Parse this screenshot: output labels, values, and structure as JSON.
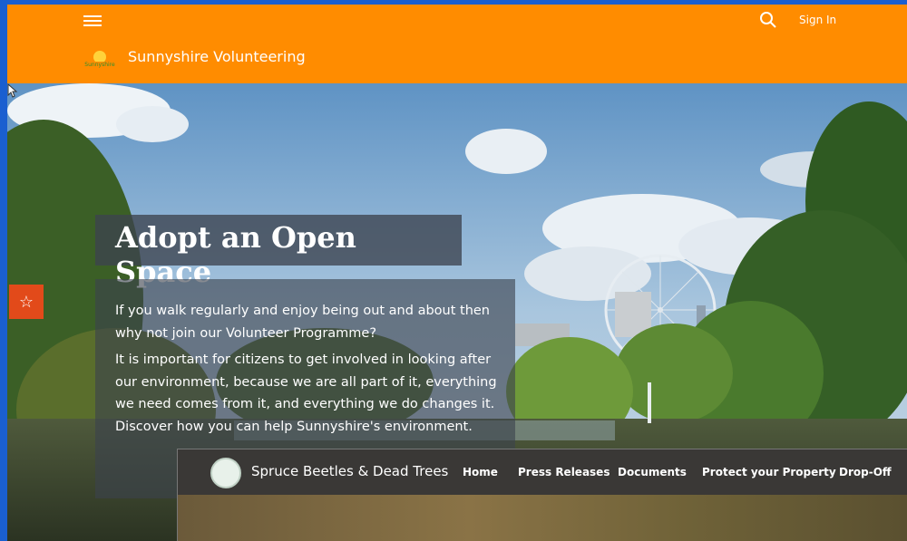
{
  "header": {
    "menu_icon": "hamburger-menu-icon",
    "search_icon": "search-icon",
    "sign_in": "Sign In",
    "site_title": "Sunnyshire Volunteering",
    "logo_text": "Sunnyshire",
    "bg_color": "#ff8c00"
  },
  "sidebar": {
    "favorite_icon": "star-icon",
    "favorite_glyph": "☆",
    "color": "#e24a1a"
  },
  "hero": {
    "title": "Adopt an Open Space",
    "paragraph1": "If you walk regularly and enjoy being out and about then why not join our Volunteer Programme?",
    "paragraph2": "It is important for citizens to get involved in looking after our environment, because we are all part of it, everything we need comes from it, and everything we do changes it. Discover how you can help Sunnyshire's environment."
  },
  "app_bar": {
    "title": "Spruce Beetles & Dead Trees",
    "nav": [
      "Home",
      "Press Releases",
      "Documents",
      "Protect your Property",
      "Drop-Off"
    ]
  }
}
